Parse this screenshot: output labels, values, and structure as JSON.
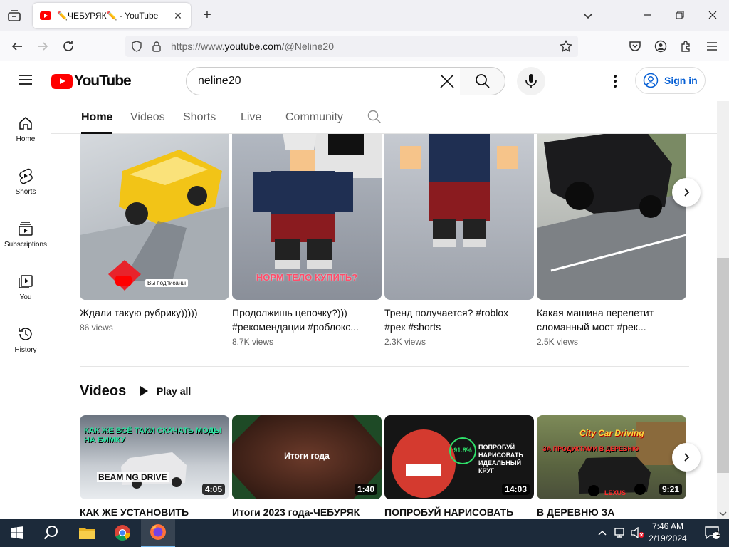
{
  "browser": {
    "tab_title": "✏️ЧЕБУРЯК✏️ - YouTube",
    "url_prefix": "https://www.",
    "url_domain": "youtube.com",
    "url_path": "/@Neline20",
    "new_tab_glyph": "+",
    "close_glyph": "✕"
  },
  "youtube": {
    "logo_text": "YouTube",
    "search_value": "neline20",
    "signin_label": "Sign in"
  },
  "sidebar": {
    "items": [
      {
        "label": "Home",
        "icon": "home-icon"
      },
      {
        "label": "Shorts",
        "icon": "shorts-icon"
      },
      {
        "label": "Subscriptions",
        "icon": "subscriptions-icon"
      },
      {
        "label": "You",
        "icon": "you-icon"
      },
      {
        "label": "History",
        "icon": "history-icon"
      }
    ]
  },
  "channel_tabs": [
    "Home",
    "Videos",
    "Shorts",
    "Live",
    "Community"
  ],
  "shorts": [
    {
      "title": "Ждали такую рубрику)))))",
      "views": "86 views",
      "overlay_text": "Вы подписаны"
    },
    {
      "title": "Продолжишь цепочку?))) #рекомендации #роблокс...",
      "views": "8.7K views",
      "overlay_text": "НОРМ ТЕЛО КУПИТЬ?"
    },
    {
      "title": "Тренд получается? #roblox #рек #shorts",
      "views": "2.3K views"
    },
    {
      "title": "Какая машина перелетит сломанный мост #рек...",
      "views": "2.5K views"
    }
  ],
  "videos_section": {
    "heading": "Videos",
    "play_all": "Play all",
    "items": [
      {
        "title": "КАК ЖЕ УСТАНОВИТЬ",
        "duration": "4:05",
        "thumb_text": "КАК ЖЕ ВСЁ ТАКИ СКАЧАТЬ МОДЫ НА БИМКУ",
        "thumb_sub": "BEAM NG DRIVE"
      },
      {
        "title": "Итоги 2023 года-ЧЕБУРЯК",
        "duration": "1:40",
        "thumb_text": "Итоги года"
      },
      {
        "title": "ПОПРОБУЙ НАРИСОВАТЬ",
        "duration": "14:03",
        "thumb_text": "ПОПРОБУЙ НАРИСОВАТЬ ИДЕАЛЬНЫЙ КРУГ",
        "thumb_sub": "91.8%"
      },
      {
        "title": "В ДЕРЕВНЮ ЗА",
        "duration": "9:21",
        "thumb_text": "City Car Driving",
        "thumb_sub": "ЗА ПРОДУКТАМИ В ДЕРЕВНЮ",
        "thumb_sub2": "LEXUS"
      }
    ]
  },
  "taskbar": {
    "time": "7:46 AM",
    "date": "2/19/2024",
    "notification_count": "1"
  }
}
